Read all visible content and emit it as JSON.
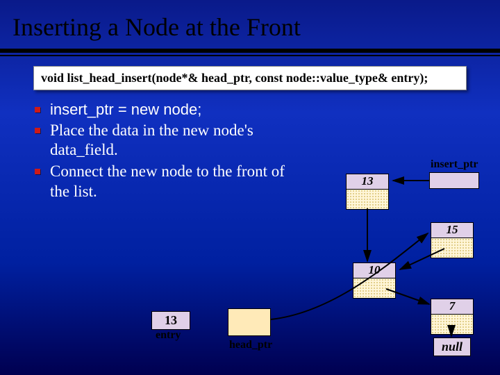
{
  "title": "Inserting a Node at the Front",
  "signature": "void list_head_insert(node*& head_ptr, const node::value_type& entry);",
  "bullets": {
    "b0": "insert_ptr = new node;",
    "b1": "Place the data in the new node's data_field.",
    "b2": "Connect the new node to the front of the list."
  },
  "labels": {
    "insert_ptr": "insert_ptr",
    "entry": "entry",
    "head_ptr": "head_ptr",
    "null": "null"
  },
  "values": {
    "thirteen_a": "13",
    "thirteen_b": "13",
    "fifteen": "15",
    "ten": "10",
    "seven": "7"
  }
}
